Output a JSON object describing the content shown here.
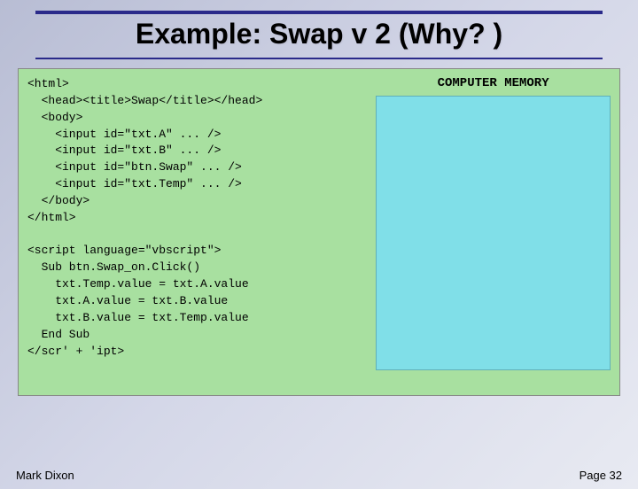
{
  "title": "Example: Swap v 2 (Why? )",
  "memory_heading": "COMPUTER MEMORY",
  "code_lines": [
    "<html>",
    "  <head><title>Swap</title></head>",
    "  <body>",
    "    <input id=\"txt.A\" ... />",
    "    <input id=\"txt.B\" ... />",
    "    <input id=\"btn.Swap\" ... />",
    "    <input id=\"txt.Temp\" ... />",
    "  </body>",
    "</html>",
    "",
    "<script language=\"vbscript\">",
    "  Sub btn.Swap_on.Click()",
    "    txt.Temp.value = txt.A.value",
    "    txt.A.value = txt.B.value",
    "    txt.B.value = txt.Temp.value",
    "  End Sub",
    "</scr' + 'ipt>"
  ],
  "footer": {
    "author": "Mark Dixon",
    "page": "Page 32"
  }
}
